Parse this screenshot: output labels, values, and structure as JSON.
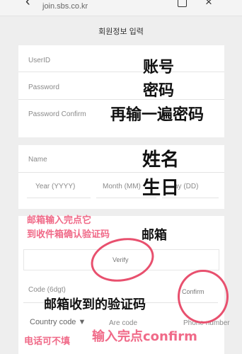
{
  "browser": {
    "url": "join.sbs.co.kr"
  },
  "page": {
    "title": "회원정보 입력"
  },
  "account": {
    "userid_label": "UserID",
    "password_label": "Password",
    "password_confirm_label": "Password Confirm"
  },
  "profile": {
    "name_label": "Name",
    "year_placeholder": "Year (YYYY)",
    "month_placeholder": "Month (MM)",
    "day_placeholder": "ay (DD)"
  },
  "email": {
    "verify_label": "Verify",
    "code_label": "Code (6dgt)",
    "confirm_label": "Confirm"
  },
  "phone": {
    "country_code_label": "Country code ▼",
    "area_code_label": "Are code",
    "phone_number_label": "Phone number"
  },
  "annotations": {
    "userid": "账号",
    "password": "密码",
    "password_confirm": "再输一遍密码",
    "name": "姓名",
    "birthday": "生日",
    "email_note_line1": "邮箱输入完点它",
    "email_note_line2": "到收件箱确认验证码",
    "email": "邮箱",
    "code": "邮箱收到的验证码",
    "phone_optional": "电话可不填",
    "confirm_note": "输入完点confirm"
  },
  "colors": {
    "annotation_pink": "#f06a88",
    "circle_red": "#e8506e"
  }
}
